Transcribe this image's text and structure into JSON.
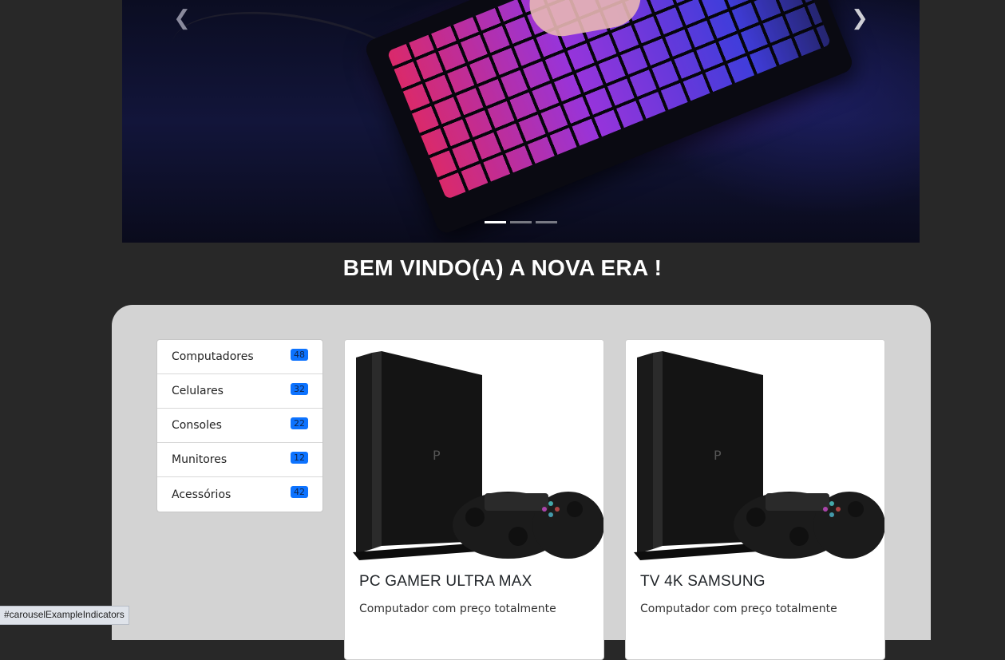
{
  "carousel": {
    "prev_icon": "chevron-left-icon",
    "next_icon": "chevron-right-icon",
    "indicators": [
      {
        "active": true
      },
      {
        "active": false
      },
      {
        "active": false
      }
    ]
  },
  "welcome": {
    "title": "BEM VINDO(A) A NOVA ERA !"
  },
  "categories": [
    {
      "label": "Computadores",
      "count": "48"
    },
    {
      "label": "Celulares",
      "count": "32"
    },
    {
      "label": "Consoles",
      "count": "22"
    },
    {
      "label": "Munitores",
      "count": "12"
    },
    {
      "label": "Acessórios",
      "count": "42"
    }
  ],
  "products": [
    {
      "title": "PC GAMER ULTRA MAX",
      "text": "Computador com preço totalmente"
    },
    {
      "title": "TV 4K SAMSUNG",
      "text": "Computador com preço totalmente"
    }
  ],
  "status_bar": {
    "url": "#carouselExampleIndicators"
  },
  "colors": {
    "badge": "#0d73ff",
    "content_bg": "#d3d3d3",
    "page_bg": "#282828"
  }
}
